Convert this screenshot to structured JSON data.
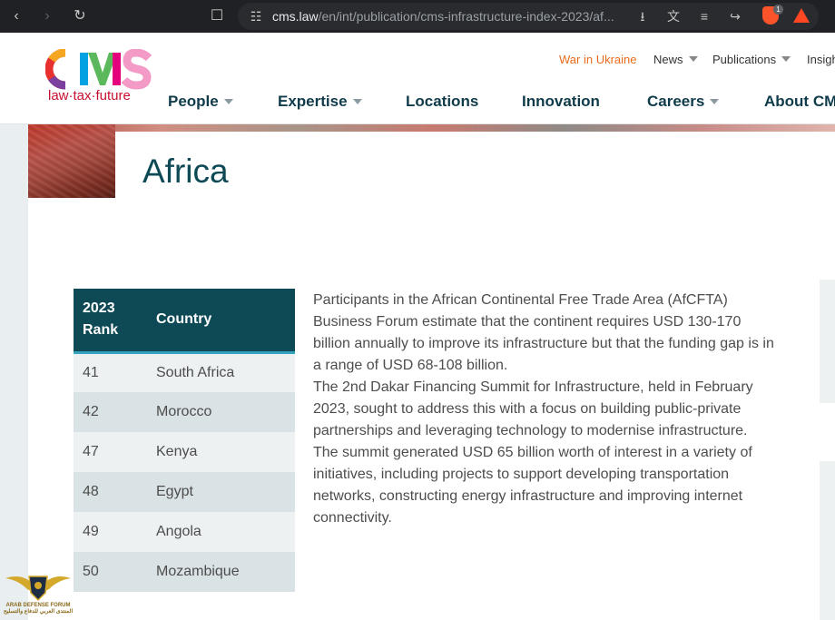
{
  "browser": {
    "url_domain": "cms.law",
    "url_path": "/en/int/publication/cms-infrastructure-index-2023/af...",
    "extension_badge": "1"
  },
  "header": {
    "logo_text": "CMS",
    "tagline": "law·tax·future",
    "utility": [
      {
        "label": "War in Ukraine"
      },
      {
        "label": "News"
      },
      {
        "label": "Publications"
      },
      {
        "label": "Insigh"
      }
    ],
    "nav": [
      {
        "label": "People"
      },
      {
        "label": "Expertise"
      },
      {
        "label": "Locations"
      },
      {
        "label": "Innovation"
      },
      {
        "label": "Careers"
      },
      {
        "label": "About CM"
      }
    ]
  },
  "page": {
    "title": "Africa",
    "table": {
      "headers": [
        "2023 Rank",
        "Country"
      ],
      "rows": [
        {
          "rank": "41",
          "country": "South Africa"
        },
        {
          "rank": "42",
          "country": "Morocco"
        },
        {
          "rank": "47",
          "country": "Kenya"
        },
        {
          "rank": "48",
          "country": "Egypt"
        },
        {
          "rank": "49",
          "country": "Angola"
        },
        {
          "rank": "50",
          "country": "Mozambique"
        }
      ]
    },
    "paragraphs": [
      "Participants in the African Continental Free Trade Area (AfCFTA) Business Forum estimate that the continent requires USD 130-170 billion annually to improve its infrastructure but that the funding gap is in a range of USD 68-108 billion.",
      "The 2nd Dakar Financing Summit for Infrastructure, held in February 2023, sought to address this with a focus on building public-private partnerships and leveraging technology to modernise infrastructure.",
      "The summit generated USD 65 billion worth of interest in a variety of initiatives, including projects to support developing transportation networks, constructing energy infrastructure and improving internet connectivity."
    ]
  },
  "watermark": {
    "line1": "ARAB DEFENSE FORUM",
    "line2": "المنتدى العربي للدفاع والتسليح"
  },
  "colors": {
    "brand_teal": "#0d4a55",
    "accent_orange": "#e86b1b",
    "header_rule": "#35a2c0"
  }
}
